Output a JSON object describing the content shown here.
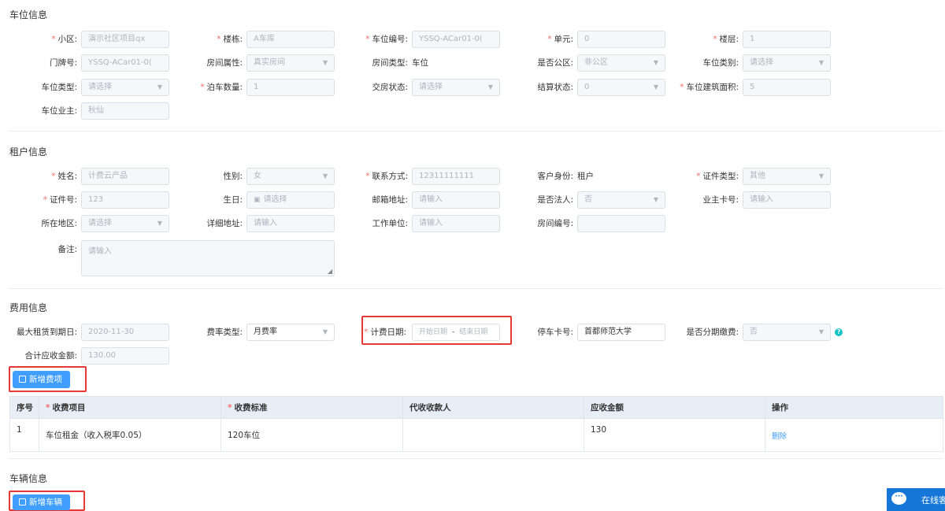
{
  "parking_info": {
    "title": "车位信息",
    "community": {
      "label": "小区:",
      "value": "演示社区项目qx"
    },
    "building": {
      "label": "楼栋:",
      "value": "A车库"
    },
    "space_no": {
      "label": "车位编号:",
      "value": "YSSQ-ACar01-0("
    },
    "unit": {
      "label": "单元:",
      "value": "0"
    },
    "floor": {
      "label": "楼层:",
      "value": "1"
    },
    "door_no": {
      "label": "门牌号:",
      "value": "YSSQ-ACar01-0("
    },
    "room_attr": {
      "label": "房间属性:",
      "value": "真实房间"
    },
    "room_type": {
      "label": "房间类型:",
      "value": "车位"
    },
    "is_public": {
      "label": "是否公区:",
      "value": "非公区"
    },
    "space_category": {
      "label": "车位类别:",
      "placeholder": "请选择"
    },
    "space_type": {
      "label": "车位类型:",
      "placeholder": "请选择"
    },
    "park_count": {
      "label": "泊车数量:",
      "value": "1"
    },
    "handover_status": {
      "label": "交房状态:",
      "placeholder": "请选择"
    },
    "settle_status": {
      "label": "结算状态:",
      "value": "0"
    },
    "building_area": {
      "label": "车位建筑面积:",
      "value": "5"
    },
    "owner": {
      "label": "车位业主:",
      "value": "秋仙"
    }
  },
  "tenant_info": {
    "title": "租户信息",
    "name": {
      "label": "姓名:",
      "value": "计费云产品"
    },
    "gender": {
      "label": "性别:",
      "value": "女"
    },
    "contact": {
      "label": "联系方式:",
      "value": "12311111111"
    },
    "identity": {
      "label": "客户身份:",
      "value": "租户"
    },
    "id_type": {
      "label": "证件类型:",
      "value": "其他"
    },
    "id_no": {
      "label": "证件号:",
      "value": "123"
    },
    "birthday": {
      "label": "生日:",
      "placeholder": "请选择"
    },
    "email": {
      "label": "邮箱地址:",
      "placeholder": "请输入"
    },
    "is_legal": {
      "label": "是否法人:",
      "value": "否"
    },
    "owner_card": {
      "label": "业主卡号:",
      "placeholder": "请输入"
    },
    "region": {
      "label": "所在地区:",
      "placeholder": "请选择"
    },
    "address": {
      "label": "详细地址:",
      "placeholder": "请输入"
    },
    "work_unit": {
      "label": "工作单位:",
      "placeholder": "请输入"
    },
    "room_no": {
      "label": "房间编号:",
      "value": ""
    },
    "remark": {
      "label": "备注:",
      "placeholder": "请输入"
    }
  },
  "fee_info": {
    "title": "费用信息",
    "max_lease_date": {
      "label": "最大租赁到期日:",
      "value": "2020-11-30"
    },
    "rate_type": {
      "label": "费率类型:",
      "value": "月费率"
    },
    "billing_date": {
      "label": "计费日期:",
      "start_placeholder": "开始日期",
      "separator": "-",
      "end_placeholder": "结束日期"
    },
    "parking_card": {
      "label": "停车卡号:",
      "value": "首都师范大学"
    },
    "installment": {
      "label": "是否分期缴费:",
      "value": "否"
    },
    "total_receivable": {
      "label": "合计应收金额:",
      "value": "130.00"
    },
    "add_fee_button": "新增费项",
    "table": {
      "headers": [
        "序号",
        "收费项目",
        "收费标准",
        "代收收款人",
        "应收金额",
        "操作"
      ],
      "rows": [
        {
          "index": "1",
          "item": "车位租金（收入税率0.05）",
          "standard": "120车位",
          "collector": "",
          "amount": "130",
          "action": "删除"
        }
      ]
    }
  },
  "vehicle_info": {
    "title": "车辆信息",
    "add_vehicle_button": "新增车辆"
  },
  "chat_widget": {
    "label": "在线客服"
  },
  "icons": {
    "dropdown": "chevron-down-icon",
    "calendar": "calendar-icon",
    "add": "add-note-icon",
    "help": "question-icon",
    "chat": "chat-bubble-icon"
  },
  "colors": {
    "primary": "#409eff",
    "required": "#f56c6c",
    "highlight": "#e53935",
    "chat": "#1677d9"
  }
}
